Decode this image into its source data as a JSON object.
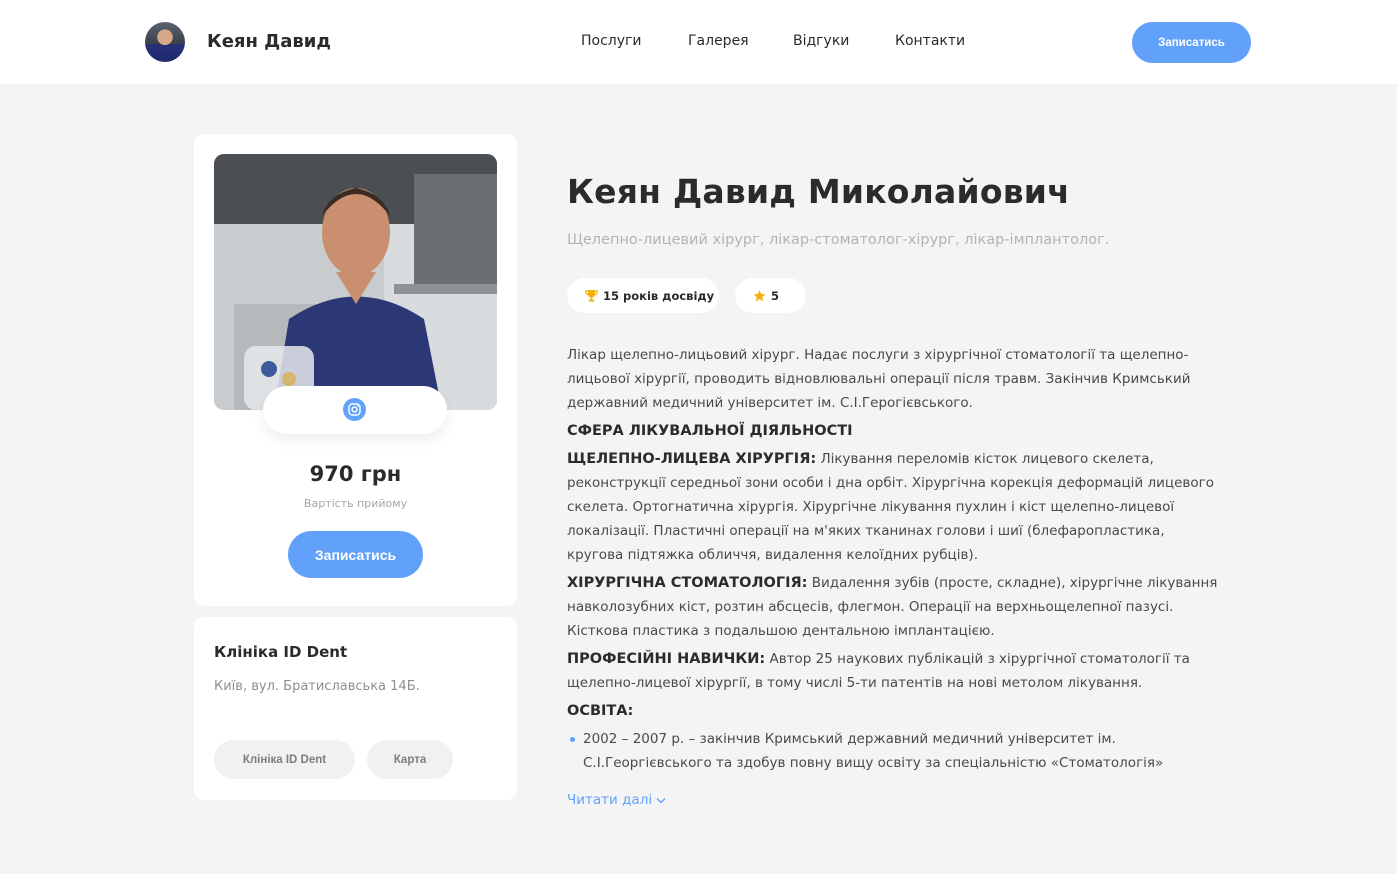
{
  "header": {
    "brand_name": "Кеян Давид",
    "nav": [
      "Послуги",
      "Галерея",
      "Відгуки",
      "Контакти"
    ],
    "book_label": "Записатись"
  },
  "profile_card": {
    "price": "970 грн",
    "price_label": "Вартість прийому",
    "book_label": "Записатись",
    "social_icon": "instagram-icon"
  },
  "clinic_card": {
    "name": "Клініка ID Dent",
    "address": "Київ, вул. Братиславська 14Б.",
    "chips": [
      "Клініка ID Dent",
      "Карта"
    ]
  },
  "doctor": {
    "full_name": "Кеян Давид Миколайович",
    "specialties": "Щелепно-лицевий хірург, лікар-стоматолог-хірург, лікар-імплантолог.",
    "experience_badge": "15 років досвіду",
    "rating_badge": "5"
  },
  "bio": {
    "intro": [
      "Лікар щелепно-лицьовий хірург. Надає послуги з хірургічної стоматології та щелепно-",
      "лицьової хірургії, проводить відновлювальні операції після травм. Закінчив Кримський",
      "державний медичний університет ім. С.І.Герогієвського."
    ],
    "section_title": "СФЕРА ЛІКУВАЛЬНОЇ ДІЯЛЬНОСТІ",
    "surgery_title": "ЩЕЛЕПНО-ЛИЦЕВА ХІРУРГІЯ:",
    "surgery_first": "Лікування переломів кісток лицевого скелета,",
    "surgery_rest": [
      "реконструкції середньої зони особи і дна орбіт. Хірургічна корекція деформацій лицевого",
      "скелета. Ортогнатична хірургія. Хірургічне лікування пухлин і кіст щелепно-лицевої",
      "локалізації. Пластичні операції на м'яких тканинах голови і шиї (блефаропластика,",
      "кругова підтяжка обличчя, видалення келоїдних рубців)."
    ],
    "dental_title": "ХІРУРГІЧНА СТОМАТОЛОГІЯ:",
    "dental_first": "Видалення зубів (просте, складне), хірургічне лікування",
    "dental_rest": [
      "навколозубних кіст, розтин абсцесів, флегмон. Операції на верхньощелепної пазусі.",
      "Кісткова пластика з подальшою дентальною імплантацією."
    ],
    "skills_title": "ПРОФЕСІЙНІ НАВИЧКИ:",
    "skills_first": "Автор 25 наукових публікацій з хірургічної стоматології та",
    "skills_rest": [
      "щелепно-лицевої хірургії, в тому числі 5-ти патентів на нові метолом лікування."
    ],
    "education_title": "ОСВІТА:",
    "education_lines": [
      "2002 – 2007 р. – закінчив Кримський державний медичний університет ім.",
      "С.І.Георгієвського та здобув повну вищу освіту за спеціальністю «Стоматологія»"
    ]
  },
  "read_more_label": "Читати далі"
}
